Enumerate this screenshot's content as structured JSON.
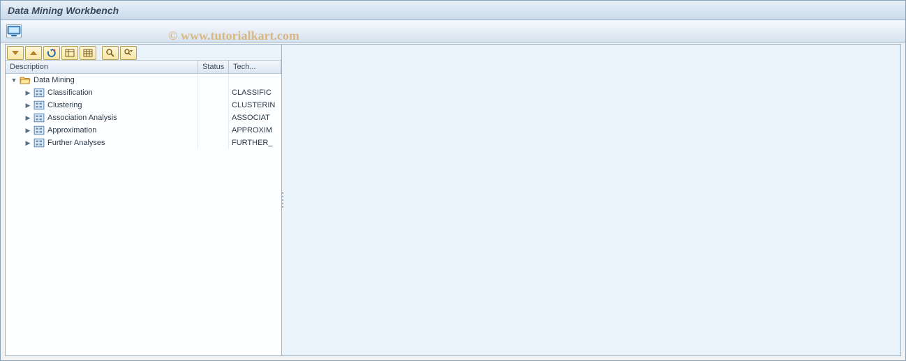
{
  "header": {
    "title": "Data Mining Workbench"
  },
  "watermark": "© www.tutorialkart.com",
  "app_toolbar": {
    "buttons": [
      {
        "name": "display-button",
        "icon": "display-icon"
      }
    ]
  },
  "tree_toolbar": {
    "buttons": [
      {
        "name": "expand-all-button",
        "icon": "expand-all-icon"
      },
      {
        "name": "collapse-all-button",
        "icon": "collapse-all-icon"
      },
      {
        "name": "refresh-button",
        "icon": "refresh-icon"
      },
      {
        "name": "select-layout-button",
        "icon": "select-layout-icon"
      },
      {
        "name": "column-config-button",
        "icon": "column-config-icon"
      },
      {
        "sep": true
      },
      {
        "name": "find-button",
        "icon": "find-icon"
      },
      {
        "name": "find-next-button",
        "icon": "find-next-icon"
      }
    ]
  },
  "tree": {
    "columns": {
      "description": "Description",
      "status": "Status",
      "tech": "Tech..."
    },
    "root": {
      "label": "Data Mining",
      "expanded": true,
      "icon": "folder-open-icon",
      "children": [
        {
          "label": "Classification",
          "tech": "CLASSIFIC",
          "icon": "object-icon"
        },
        {
          "label": "Clustering",
          "tech": "CLUSTERIN",
          "icon": "object-icon"
        },
        {
          "label": "Association Analysis",
          "tech": "ASSOCIAT",
          "icon": "object-icon"
        },
        {
          "label": "Approximation",
          "tech": "APPROXIM",
          "icon": "object-icon"
        },
        {
          "label": "Further Analyses",
          "tech": "FURTHER_",
          "icon": "object-icon"
        }
      ]
    }
  }
}
